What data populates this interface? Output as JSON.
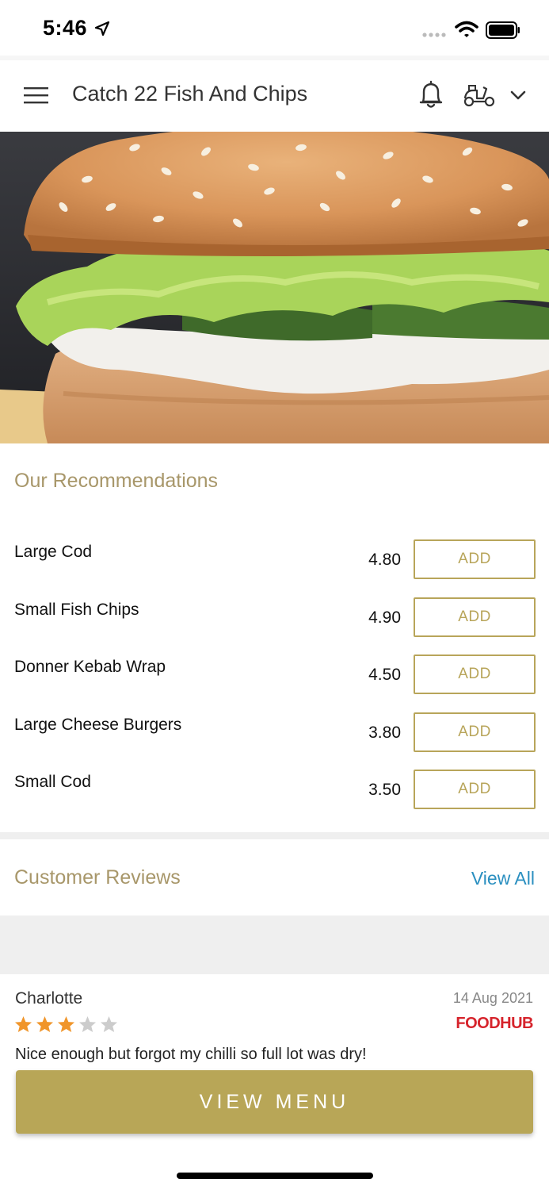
{
  "status_bar": {
    "time": "5:46",
    "icons": [
      "location-arrow-icon",
      "cellular-signal-icon",
      "wifi-icon",
      "battery-icon"
    ]
  },
  "header": {
    "title": "Catch 22 Fish And Chips",
    "icons": [
      "hamburger-menu-icon",
      "bell-icon",
      "scooter-icon",
      "chevron-down-icon"
    ]
  },
  "hero": {
    "image": "burger-photo"
  },
  "recommendations": {
    "title": "Our Recommendations",
    "items": [
      {
        "name": "Large Cod",
        "price": "4.80",
        "button": "ADD"
      },
      {
        "name": "Small Fish Chips",
        "price": "4.90",
        "button": "ADD"
      },
      {
        "name": "Donner Kebab Wrap",
        "price": "4.50",
        "button": "ADD"
      },
      {
        "name": "Large Cheese Burgers",
        "price": "3.80",
        "button": "ADD"
      },
      {
        "name": "Small Cod",
        "price": "3.50",
        "button": "ADD"
      }
    ]
  },
  "reviews": {
    "title": "Customer Reviews",
    "view_all": "View All",
    "items": [
      {
        "author": "Charlotte",
        "date": "14 Aug 2021",
        "rating": 3,
        "rating_max": 5,
        "source": "FOODHUB",
        "text": "Nice enough but forgot my chilli so full lot was dry!"
      }
    ]
  },
  "footer": {
    "view_menu": "VIEW MENU"
  },
  "colors": {
    "accent_gold": "#b8a657",
    "section_title": "#a8976a",
    "link_blue": "#2a8fc0",
    "star_filled": "#f0952a",
    "star_empty": "#cccccc",
    "foodhub_red": "#d6242c"
  }
}
